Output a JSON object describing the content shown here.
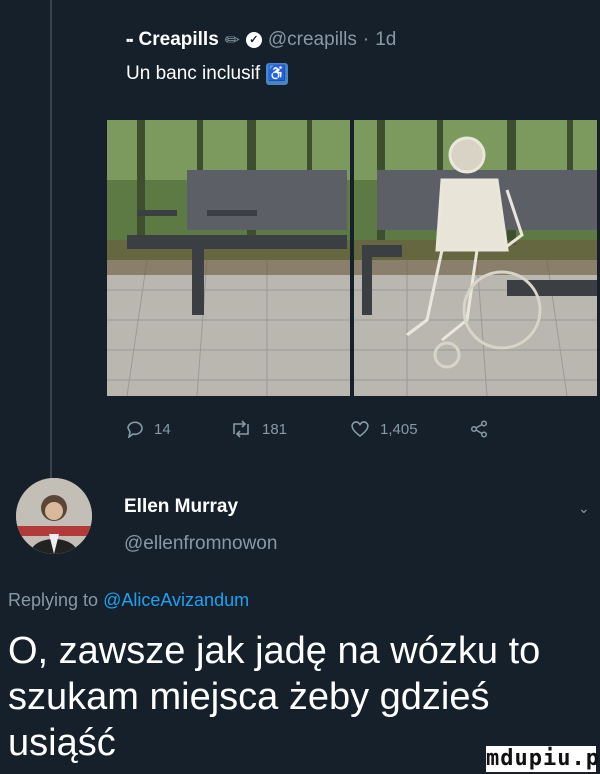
{
  "tweet1": {
    "author_name": "Creapills",
    "author_handle": "@creapills",
    "separator": "·",
    "time": "1d",
    "text": "Un banc inclusif",
    "text_emoji": "♿",
    "pencil_emoji": "✏",
    "verified_glyph": "✓",
    "actions": {
      "replies": "14",
      "retweets": "181",
      "likes": "1,405"
    }
  },
  "tweet2": {
    "author_name": "Ellen Murray",
    "author_handle": "@ellenfromnowon",
    "replying_prefix": "Replying to",
    "replying_to": "@AliceAvizandum",
    "text": "O, zawsze jak jadę na wózku to szukam miejsca żeby gdzieś usiąść"
  },
  "watermark": "mdupiu.pl",
  "colors": {
    "background": "#15202b",
    "muted": "#8899a6",
    "link": "#1da1f2"
  }
}
